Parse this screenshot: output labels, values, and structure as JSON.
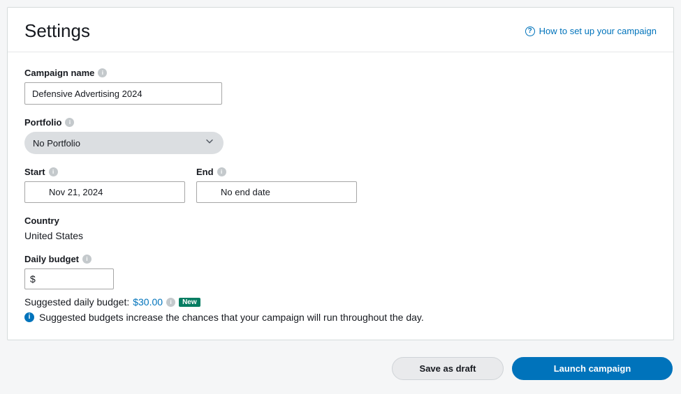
{
  "header": {
    "title": "Settings",
    "help_link": "How to set up your campaign"
  },
  "fields": {
    "campaign_name": {
      "label": "Campaign name",
      "value": "Defensive Advertising 2024"
    },
    "portfolio": {
      "label": "Portfolio",
      "value": "No Portfolio"
    },
    "start": {
      "label": "Start",
      "value": "Nov 21, 2024"
    },
    "end": {
      "label": "End",
      "value": "No end date"
    },
    "country": {
      "label": "Country",
      "value": "United States"
    },
    "budget": {
      "label": "Daily budget",
      "currency_symbol": "$",
      "value": ""
    },
    "suggested": {
      "label": "Suggested daily budget:",
      "value": "$30.00",
      "badge": "New",
      "hint": "Suggested budgets increase the chances that your campaign will run throughout the day."
    }
  },
  "actions": {
    "save_draft": "Save as draft",
    "launch": "Launch campaign"
  }
}
